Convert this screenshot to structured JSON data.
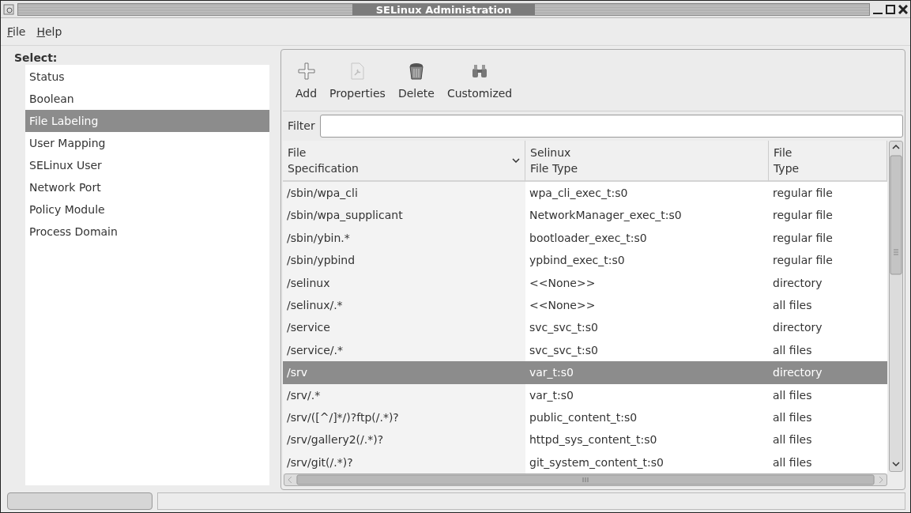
{
  "window": {
    "title": "SELinux Administration"
  },
  "menu": [
    {
      "label": "File"
    },
    {
      "label": "Help"
    }
  ],
  "sidebar": {
    "heading": "Select:",
    "items": [
      {
        "label": "Status",
        "selected": false
      },
      {
        "label": "Boolean",
        "selected": false
      },
      {
        "label": "File Labeling",
        "selected": true
      },
      {
        "label": "User Mapping",
        "selected": false
      },
      {
        "label": "SELinux User",
        "selected": false
      },
      {
        "label": "Network Port",
        "selected": false
      },
      {
        "label": "Policy Module",
        "selected": false
      },
      {
        "label": "Process Domain",
        "selected": false
      }
    ]
  },
  "toolbar": [
    {
      "label": "Add",
      "kind": "add",
      "disabled": false
    },
    {
      "label": "Properties",
      "kind": "properties",
      "disabled": true
    },
    {
      "label": "Delete",
      "kind": "delete",
      "disabled": false
    },
    {
      "label": "Customized",
      "kind": "customized",
      "disabled": false
    }
  ],
  "filter": {
    "label": "Filter"
  },
  "table": {
    "columns": [
      {
        "lines": [
          "File",
          "Specification"
        ],
        "sorted": true
      },
      {
        "lines": [
          "Selinux",
          "File Type"
        ],
        "sorted": false
      },
      {
        "lines": [
          "File",
          "Type"
        ],
        "sorted": false
      }
    ],
    "rows": [
      {
        "cells": [
          "/sbin/wpa_cli",
          "wpa_cli_exec_t:s0",
          "regular file"
        ],
        "selected": false
      },
      {
        "cells": [
          "/sbin/wpa_supplicant",
          "NetworkManager_exec_t:s0",
          "regular file"
        ],
        "selected": false
      },
      {
        "cells": [
          "/sbin/ybin.*",
          "bootloader_exec_t:s0",
          "regular file"
        ],
        "selected": false
      },
      {
        "cells": [
          "/sbin/ypbind",
          "ypbind_exec_t:s0",
          "regular file"
        ],
        "selected": false
      },
      {
        "cells": [
          "/selinux",
          "<<None>>",
          "directory"
        ],
        "selected": false
      },
      {
        "cells": [
          "/selinux/.*",
          "<<None>>",
          "all files"
        ],
        "selected": false
      },
      {
        "cells": [
          "/service",
          "svc_svc_t:s0",
          "directory"
        ],
        "selected": false
      },
      {
        "cells": [
          "/service/.*",
          "svc_svc_t:s0",
          "all files"
        ],
        "selected": false
      },
      {
        "cells": [
          "/srv",
          "var_t:s0",
          "directory"
        ],
        "selected": true
      },
      {
        "cells": [
          "/srv/.*",
          "var_t:s0",
          "all files"
        ],
        "selected": false
      },
      {
        "cells": [
          "/srv/([^/]*/)?ftp(/.*)?",
          "public_content_t:s0",
          "all files"
        ],
        "selected": false
      },
      {
        "cells": [
          "/srv/gallery2(/.*)?",
          "httpd_sys_content_t:s0",
          "all files"
        ],
        "selected": false
      },
      {
        "cells": [
          "/srv/git(/.*)?",
          "git_system_content_t:s0",
          "all files"
        ],
        "selected": false
      }
    ]
  }
}
